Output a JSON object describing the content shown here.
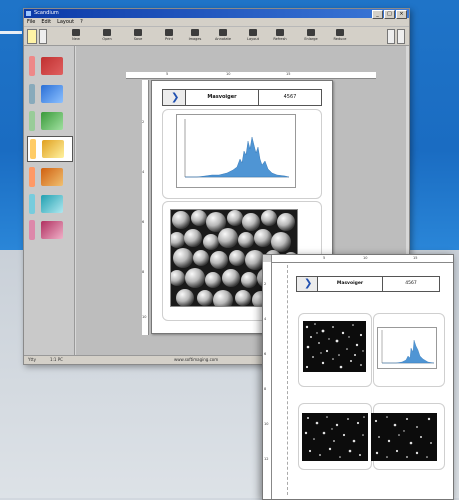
{
  "window": {
    "title": "Scandium",
    "controls": {
      "minimize": "_",
      "maximize": "□",
      "close": "×"
    }
  },
  "menu": [
    "File",
    "Edit",
    "Layout",
    "?"
  ],
  "toolbar": [
    "New",
    "Open",
    "Save",
    "Print",
    "Images",
    "Annotate",
    "Layout",
    "Refresh",
    "Enlarge",
    "Reduce"
  ],
  "sidebar": [
    {
      "icon": "book-icon",
      "color": "#c03030",
      "active": false
    },
    {
      "icon": "screens-icon",
      "color": "#2a6fd6",
      "active": false
    },
    {
      "icon": "cards-icon",
      "color": "#3a9a3a",
      "active": false
    },
    {
      "icon": "clipboard-icon",
      "color": "#e0a020",
      "active": true
    },
    {
      "icon": "camera-icon",
      "color": "#d06010",
      "active": false
    },
    {
      "icon": "cube-icon",
      "color": "#20a0b0",
      "active": false
    },
    {
      "icon": "person-icon",
      "color": "#b03060",
      "active": false
    }
  ],
  "ruler_h": [
    "5",
    "10",
    "15"
  ],
  "ruler_v": [
    "2",
    "4",
    "6",
    "8",
    "10"
  ],
  "document": {
    "title": "Masvoiger",
    "number": "4567"
  },
  "overlay": {
    "title": "Masvoiger",
    "number": "4567",
    "ruler_h": [
      "5",
      "10",
      "15"
    ],
    "ruler_v": [
      "2",
      "4",
      "6",
      "8",
      "10",
      "12"
    ]
  },
  "statusbar": {
    "left": "Ytty",
    "mid": "1:1 PC",
    "center": "www.softimaging.com"
  }
}
